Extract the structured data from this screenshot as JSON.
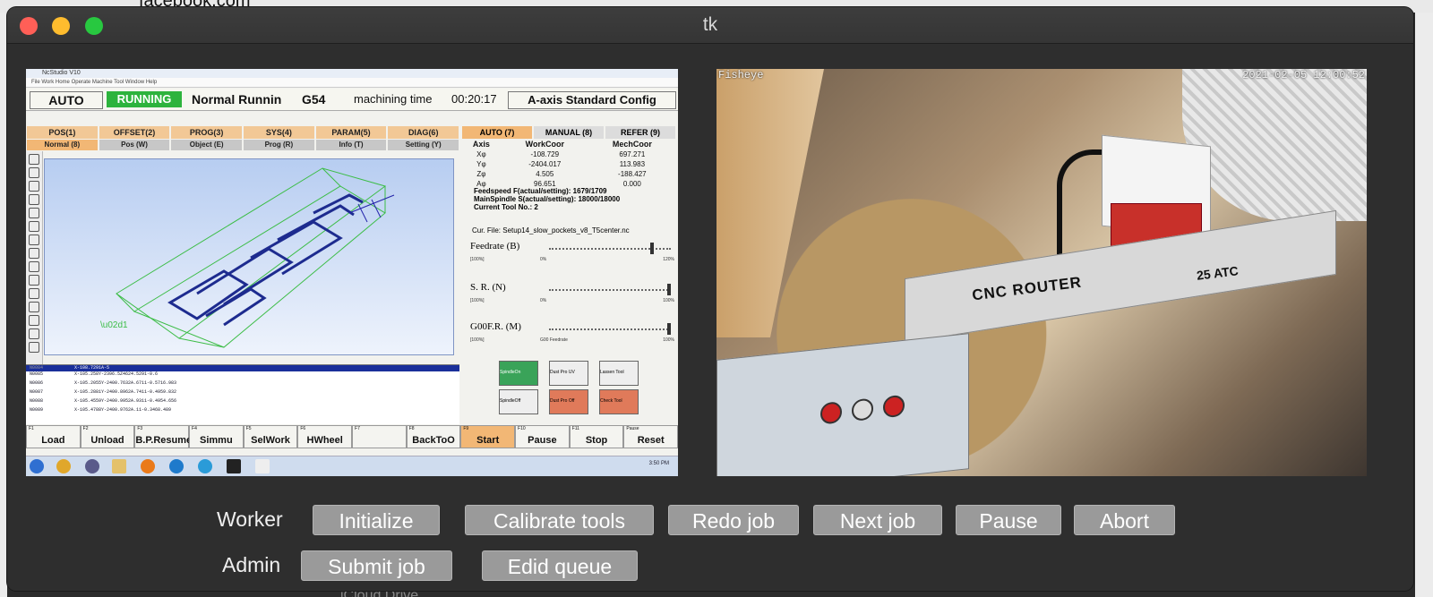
{
  "background": {
    "top_text": "facebook.com",
    "bottom_text": "iCloud Drive"
  },
  "window": {
    "title": "tk"
  },
  "cnc_screen": {
    "title": "NcStudio V10",
    "menu": "File  Work Home  Operate  Machine Tool  Window  Help",
    "status": {
      "mode": "AUTO",
      "state": "RUNNING",
      "state_text": "Normal Runnin",
      "coord": "G54",
      "time_label": "machining time",
      "time_value": "00:20:17",
      "config": "A-axis Standard Config"
    },
    "tabs_top": [
      "POS(1)",
      "OFFSET(2)",
      "PROG(3)",
      "SYS(4)",
      "PARAM(5)",
      "DIAG(6)"
    ],
    "tabs_sub": [
      "Normal (8)",
      "Pos (W)",
      "Object (E)",
      "Prog (R)",
      "Info (T)",
      "Setting (Y)"
    ],
    "tabs_right": [
      "AUTO (7)",
      "MANUAL (8)",
      "REFER (9)"
    ],
    "coords": {
      "headers": [
        "Axis",
        "WorkCoor",
        "MechCoor"
      ],
      "rows": [
        [
          "Xφ",
          "-108.729",
          "697.271"
        ],
        [
          "Yφ",
          "-2404.017",
          "113.983"
        ],
        [
          "Zφ",
          "4.505",
          "-188.427"
        ],
        [
          "Aφ",
          "96.651",
          "0.000"
        ]
      ]
    },
    "info": [
      "Feedspeed F(actual/setting): 1679/1709",
      "MainSpindle S(actual/setting): 18000/18000",
      "Current Tool No.: 2"
    ],
    "cur_file": "Cur. File: Setup14_slow_pockets_v8_T5center.nc",
    "sliders": [
      {
        "label": "Feedrate (B)",
        "left": "[100%]",
        "mid": "0%",
        "right": "120%",
        "value_pct": 86
      },
      {
        "label": "S. R. (N)",
        "left": "[100%]",
        "mid": "0%",
        "right": "100%",
        "value_pct": 100
      },
      {
        "label": "G00F.R. (M)",
        "left": "[100%]",
        "mid": "G00 Feedrate",
        "right": "100%",
        "value_pct": 100
      }
    ],
    "icon_buttons": [
      "SpindleOn",
      "Dust Pro UV",
      "Lassen Tool",
      "SpindleOff",
      "Dust Pro Off",
      "Check Tool"
    ],
    "gcode": {
      "labels": [
        "N0084",
        "N0085",
        "N0086",
        "N0087",
        "N0088",
        "N0089"
      ],
      "lines": [
        "X-108.7291A-5",
        "X-105.258Y-2396.5Z4624.5291-0.6",
        "X-105.2055Y-2400.7632A.6711-0.5716.983",
        "X-105.2881Y-2400.8962A.7411-0.4959.832",
        "X-105.4559Y-2400.9952A.9311-0.4954.656",
        "X-105.4788Y-2400.9762A.11-0.3468.489"
      ]
    },
    "fkeys": [
      {
        "n": "F1",
        "label": "Load"
      },
      {
        "n": "F2",
        "label": "Unload"
      },
      {
        "n": "F3",
        "label": "B.P.Resume"
      },
      {
        "n": "F4",
        "label": "Simmu"
      },
      {
        "n": "F5",
        "label": "SelWork"
      },
      {
        "n": "F6",
        "label": "HWheel"
      },
      {
        "n": "F7",
        "label": ""
      },
      {
        "n": "F8",
        "label": "BackToO"
      },
      {
        "n": "F9",
        "label": "Start"
      },
      {
        "n": "F10",
        "label": "Pause"
      },
      {
        "n": "F11",
        "label": "Stop"
      },
      {
        "n": "Pause",
        "label": "Reset"
      }
    ],
    "taskbar_clock": "3:50 PM"
  },
  "camera": {
    "label": "Fisheye",
    "timestamp": "2021-02-05 12:00:52",
    "gantry_text": "CNC ROUTER",
    "gantry_text2": "25 ATC"
  },
  "controls": {
    "worker_label": "Worker",
    "admin_label": "Admin",
    "worker_buttons": [
      "Initialize",
      "Calibrate tools",
      "Redo job",
      "Next job",
      "Pause",
      "Abort"
    ],
    "admin_buttons": [
      "Submit job",
      "Edid queue"
    ]
  },
  "colors": {
    "traffic_red": "#ff5f57",
    "traffic_yellow": "#febc2e",
    "traffic_green": "#28c840",
    "button_bg": "#9a9a9a",
    "running_green": "#2db33d"
  }
}
